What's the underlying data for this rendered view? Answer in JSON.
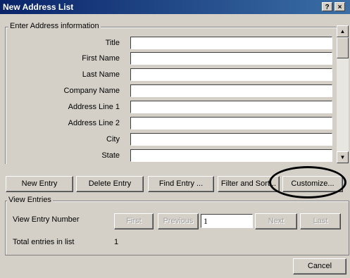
{
  "window": {
    "title": "New Address List",
    "help_btn": "?",
    "close_btn": "×"
  },
  "address_group": {
    "label": "Enter Address information",
    "fields": [
      {
        "label": "Title",
        "value": ""
      },
      {
        "label": "First Name",
        "value": ""
      },
      {
        "label": "Last Name",
        "value": ""
      },
      {
        "label": "Company Name",
        "value": ""
      },
      {
        "label": "Address Line 1",
        "value": ""
      },
      {
        "label": "Address Line 2",
        "value": ""
      },
      {
        "label": "City",
        "value": ""
      },
      {
        "label": "State",
        "value": ""
      }
    ]
  },
  "actions": {
    "new_entry": "New Entry",
    "delete_entry": "Delete Entry",
    "find_entry": "Find Entry ...",
    "filter_sort": "Filter and Sort...",
    "customize": "Customize..."
  },
  "view_group": {
    "label": "View Entries",
    "entry_number_label": "View Entry Number",
    "first": "First",
    "previous": "Previous",
    "entry_number": "1",
    "next": "Next",
    "last": "Last",
    "total_label": "Total entries in list",
    "total_value": "1"
  },
  "cancel": "Cancel"
}
